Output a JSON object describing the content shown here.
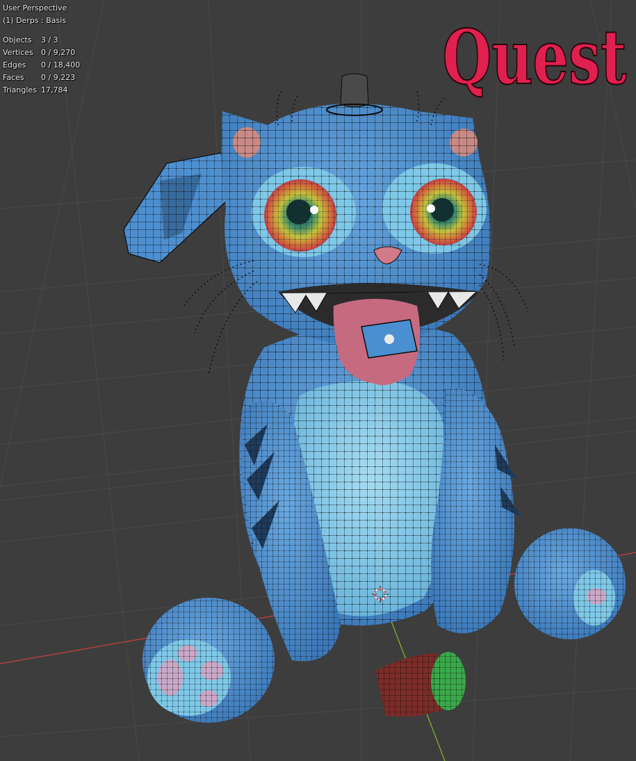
{
  "overlay": {
    "view_name": "User Perspective",
    "context": "(1) Derps : Basis",
    "stats": [
      {
        "label": "Objects",
        "value": "3 / 3"
      },
      {
        "label": "Vertices",
        "value": "0 / 9,270"
      },
      {
        "label": "Edges",
        "value": "0 / 18,400"
      },
      {
        "label": "Faces",
        "value": "0 / 9,223"
      },
      {
        "label": "Triangles",
        "value": "17,784"
      }
    ]
  },
  "watermark": {
    "text": "Quest",
    "color": "#e0204f"
  },
  "colors": {
    "background": "#3d3d3d",
    "grid": "#4a4a4a",
    "axis_x": "#b5413f",
    "axis_y": "#7aa52e",
    "body_blue": "#4d8fcf",
    "belly_blue": "#7ec8e8",
    "wire": "#0b0b0b"
  }
}
